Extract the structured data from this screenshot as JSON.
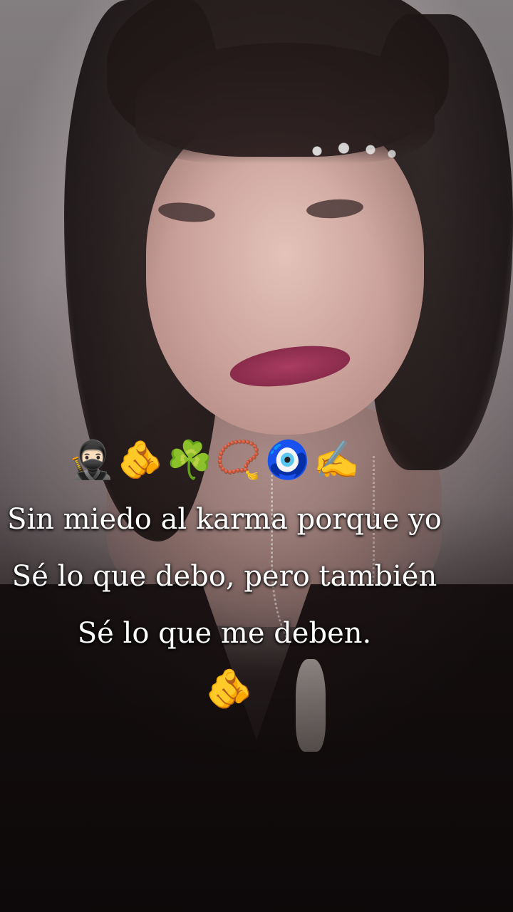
{
  "overlay": {
    "emoji_row": [
      "🥷🏻",
      "🫵",
      "☘️",
      "📿",
      "🧿",
      "✍️"
    ],
    "caption_lines": [
      "Sin miedo al karma porque yo",
      "Sé lo que debo, pero también",
      "Sé lo que me deben."
    ],
    "emoji_end": "🫵"
  },
  "colors": {
    "caption_text": "#ffffff",
    "garment": "#140e0f"
  }
}
